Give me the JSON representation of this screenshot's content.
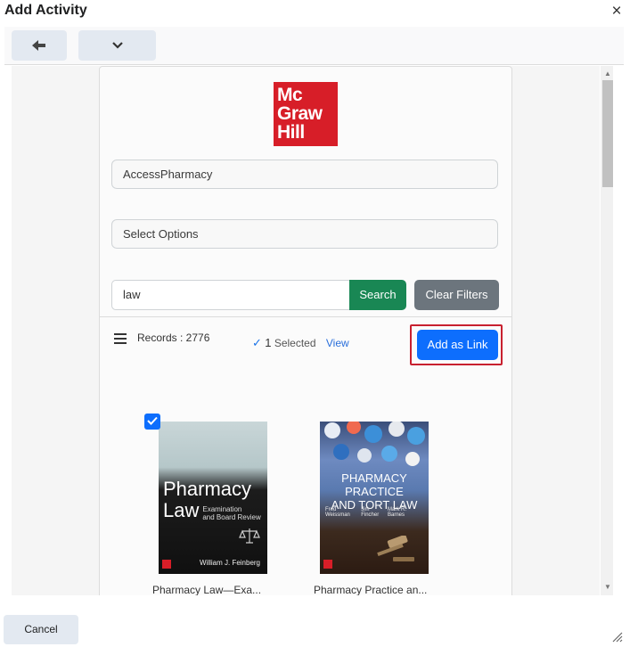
{
  "dialog": {
    "title": "Add Activity",
    "close_glyph": "×"
  },
  "toolbar": {
    "back_glyph": "🠔",
    "menu_glyph": "⌄"
  },
  "publisher_logo": {
    "lines": [
      "Mc",
      "Graw",
      "Hill"
    ],
    "color": "#d71e28"
  },
  "filters": {
    "collection_value": "AccessPharmacy",
    "options_placeholder": "Select Options",
    "search_value": "law",
    "search_label": "Search",
    "clear_label": "Clear Filters"
  },
  "results": {
    "records_text": "Records : 2776",
    "selected_check": "✓",
    "selected_count": "1",
    "selected_label": "Selected",
    "view_label": "View",
    "add_link_label": "Add as Link"
  },
  "books": [
    {
      "title_line1": "Pharmacy",
      "title_line2": "Law",
      "subtitle_line1": "Examination",
      "subtitle_line2": "and Board Review",
      "author": "William J. Feinberg",
      "caption": "Pharmacy Law—Exa...",
      "selected": true
    },
    {
      "title_line1": "PHARMACY PRACTICE",
      "title_line2": "AND TORT LAW",
      "authors": [
        "Fred Weissman",
        "Jim Fincher",
        "Mark R. Barnes"
      ],
      "caption": "Pharmacy Practice an...",
      "selected": false
    }
  ],
  "footer": {
    "cancel_label": "Cancel"
  },
  "colors": {
    "search_button": "#198754",
    "clear_button": "#6c757d",
    "primary_button": "#0d6efd",
    "highlight_border": "#c8202f"
  }
}
